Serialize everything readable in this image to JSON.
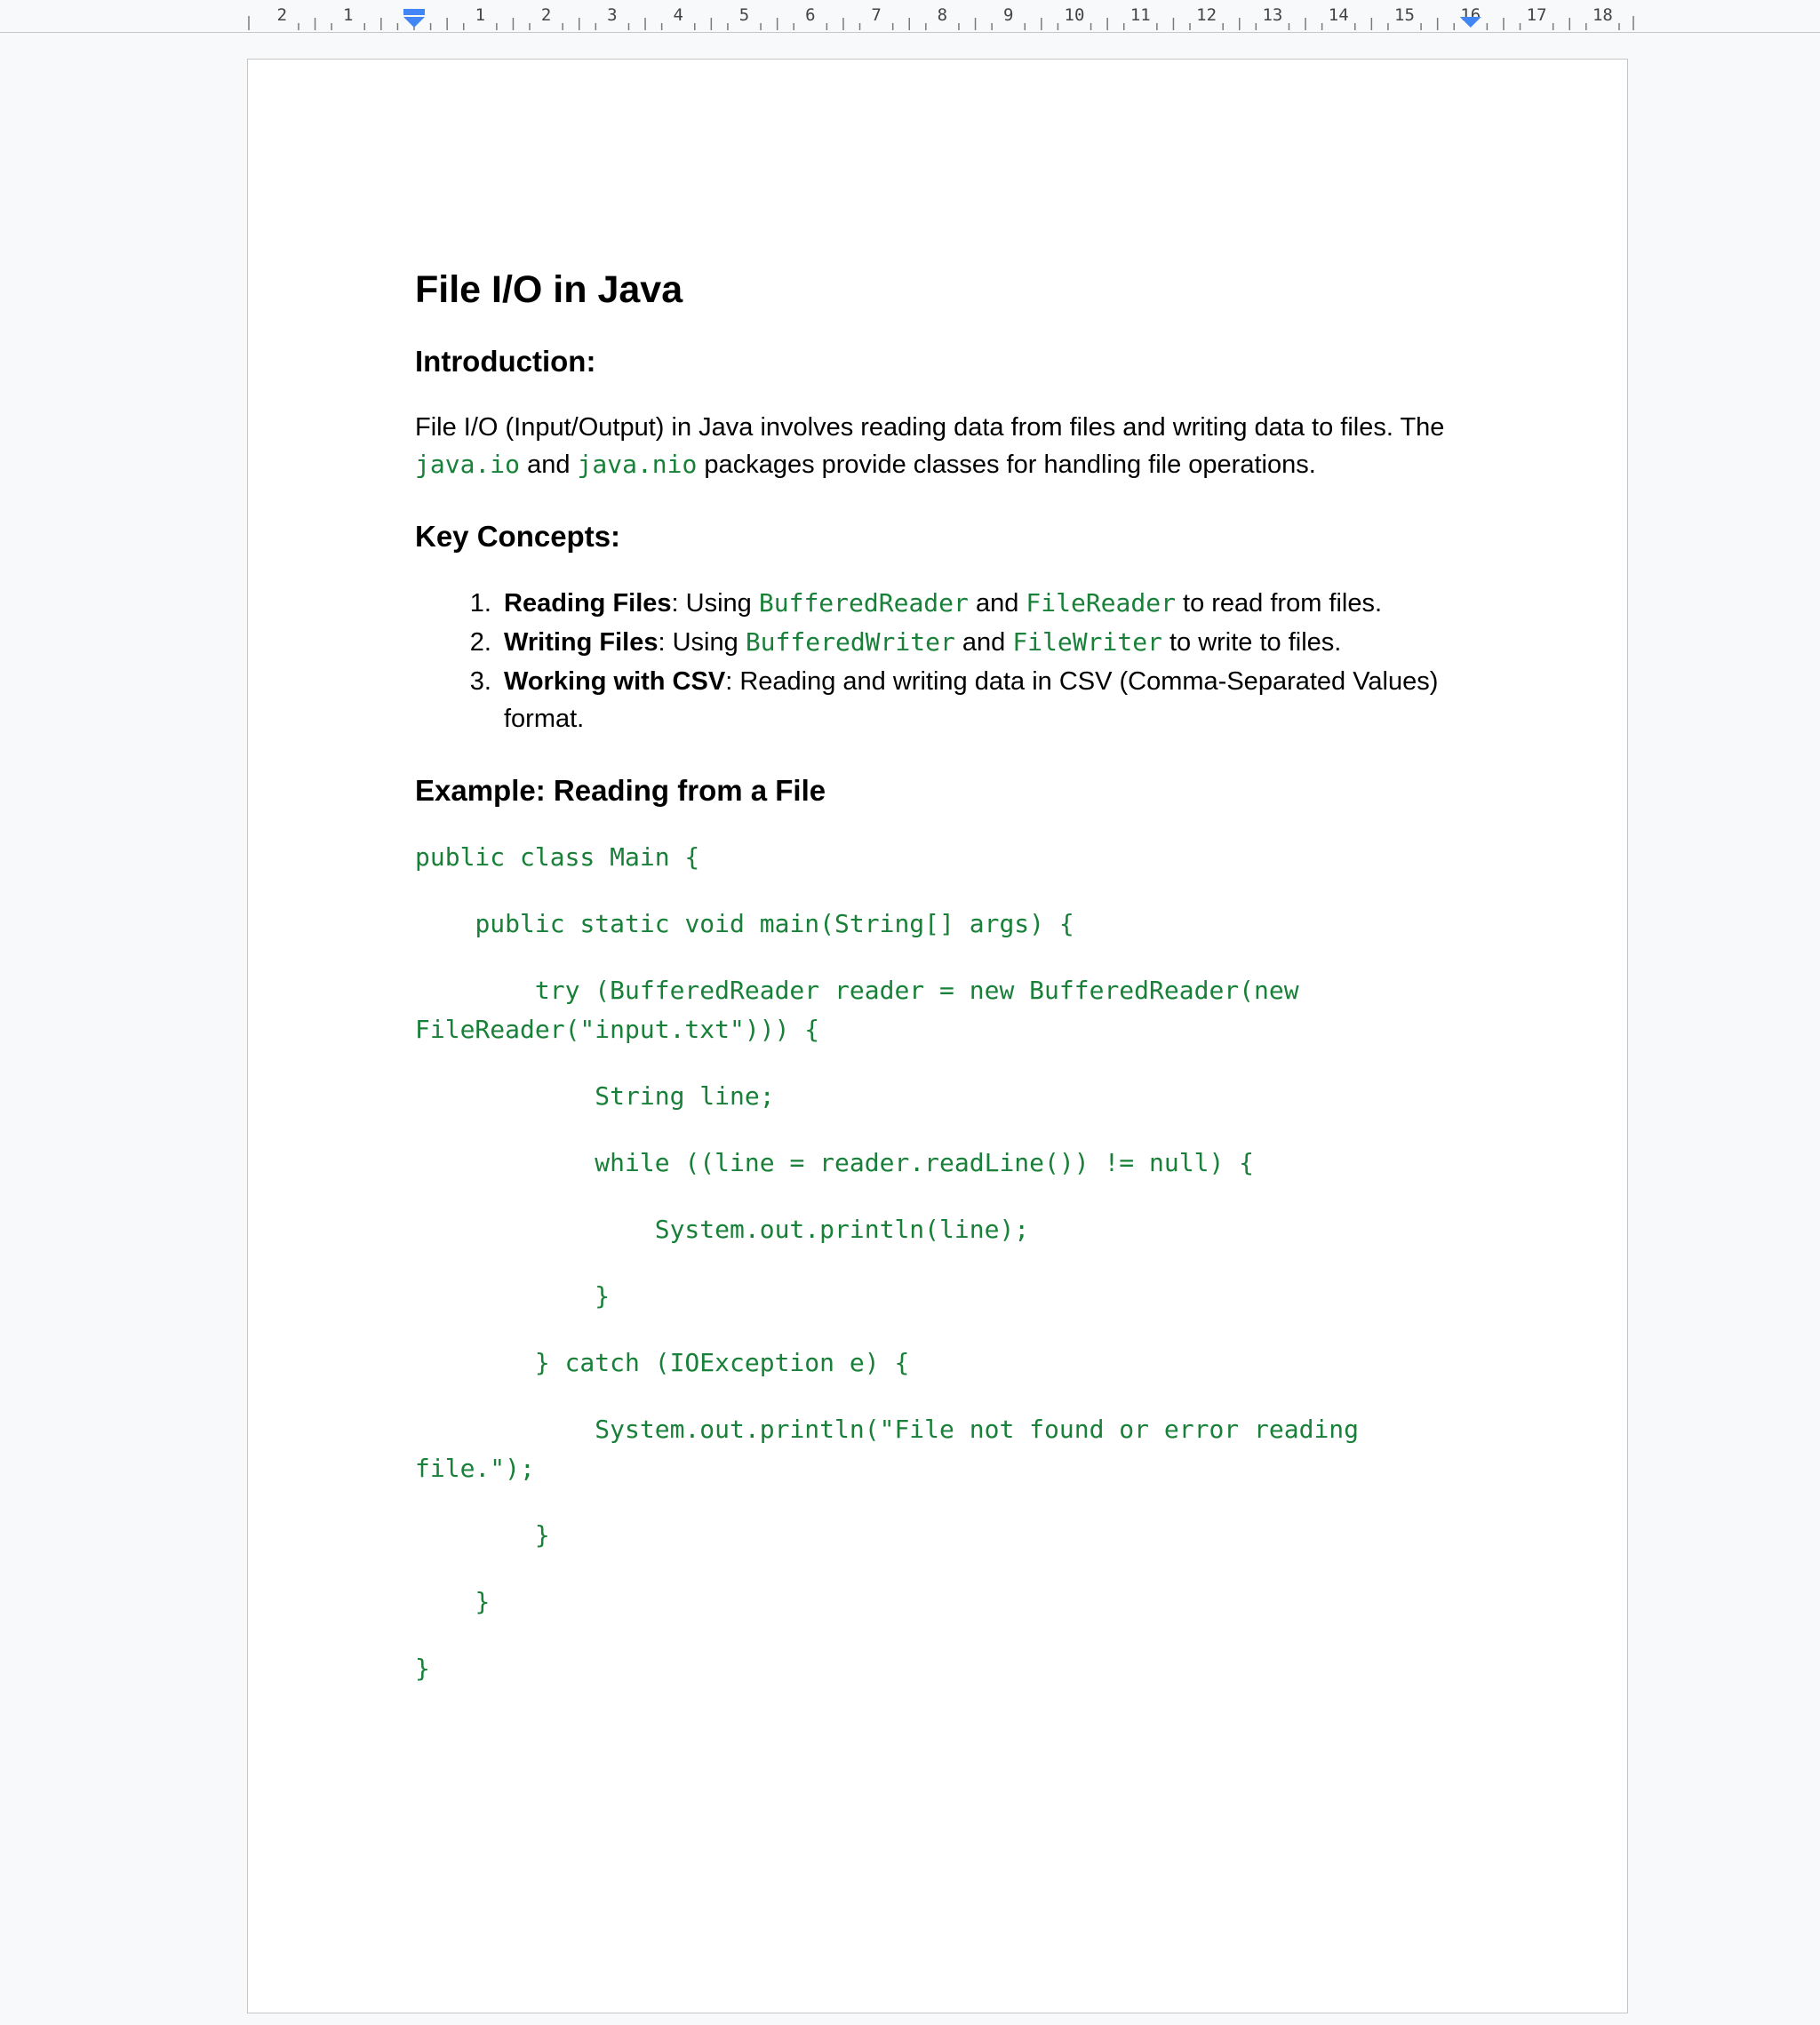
{
  "ruler": {
    "labels_left": [
      "2",
      "1"
    ],
    "labels_right": [
      "1",
      "2",
      "3",
      "4",
      "5",
      "6",
      "7",
      "8",
      "9",
      "10",
      "11",
      "12",
      "13",
      "14",
      "15",
      "16",
      "17",
      "18"
    ]
  },
  "document": {
    "title": "File I/O in Java",
    "intro_heading": "Introduction:",
    "intro_text_1": "File I/O (Input/Output) in Java involves reading data from files and writing data to files. The ",
    "intro_code_1": "java.io",
    "intro_text_2": " and ",
    "intro_code_2": "java.nio",
    "intro_text_3": " packages provide classes for handling file operations.",
    "concepts_heading": "Key Concepts:",
    "concepts": [
      {
        "bold": "Reading Files",
        "t1": ": Using ",
        "c1": "BufferedReader",
        "t2": " and ",
        "c2": "FileReader",
        "t3": " to read from files."
      },
      {
        "bold": "Writing Files",
        "t1": ": Using ",
        "c1": "BufferedWriter",
        "t2": " and ",
        "c2": "FileWriter",
        "t3": " to write to files."
      },
      {
        "bold": "Working with CSV",
        "t1": ": Reading and writing data in CSV (Comma-Separated Values) format."
      }
    ],
    "example_heading": "Example: Reading from a File",
    "code_lines": [
      "public class Main {",
      "    public static void main(String[] args) {",
      "        try (BufferedReader reader = new BufferedReader(new FileReader(\"input.txt\"))) {",
      "            String line;",
      "            while ((line = reader.readLine()) != null) {",
      "                System.out.println(line);",
      "            }",
      "        } catch (IOException e) {",
      "            System.out.println(\"File not found or error reading file.\");",
      "        }",
      "    }",
      "}"
    ]
  },
  "colors": {
    "code": "#188038",
    "ruler_marker": "#4285f4"
  }
}
